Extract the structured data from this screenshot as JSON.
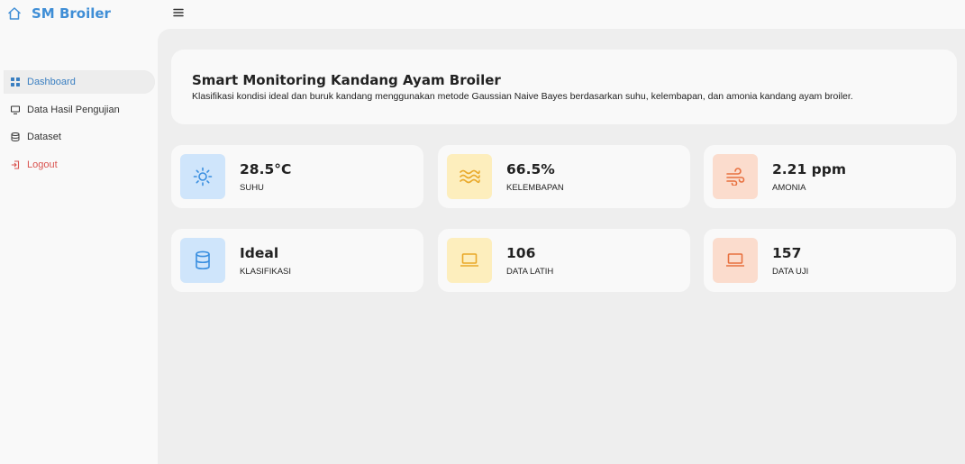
{
  "brand": {
    "name": "SM Broiler",
    "icon": "home-icon"
  },
  "topbar": {
    "menu_icon": "hamburger-icon"
  },
  "sidebar": {
    "items": [
      {
        "label": "Dashboard",
        "icon": "grid-icon",
        "active": true
      },
      {
        "label": "Data Hasil Pengujian",
        "icon": "monitor-icon",
        "active": false
      },
      {
        "label": "Dataset",
        "icon": "database-icon",
        "active": false
      },
      {
        "label": "Logout",
        "icon": "logout-icon",
        "active": false
      }
    ]
  },
  "hero": {
    "title": "Smart Monitoring Kandang Ayam Broiler",
    "subtitle": "Klasifikasi kondisi ideal dan buruk kandang menggunakan metode Gaussian Naive Bayes berdasarkan suhu, kelembapan, dan amonia kandang ayam broiler."
  },
  "cards": [
    {
      "value": "28.5°C",
      "label": "SUHU",
      "icon": "sun-icon",
      "color": "#3a8fe0"
    },
    {
      "value": "66.5%",
      "label": "KELEMBAPAN",
      "icon": "water-icon",
      "color": "#e9a92a"
    },
    {
      "value": "2.21 ppm",
      "label": "AMONIA",
      "icon": "wind-icon",
      "color": "#e8703f"
    },
    {
      "value": "Ideal",
      "label": "KLASIFIKASI",
      "icon": "database-icon",
      "color": "#3a8fe0"
    },
    {
      "value": "106",
      "label": "DATA LATIH",
      "icon": "laptop-icon",
      "color": "#e9a92a"
    },
    {
      "value": "157",
      "label": "DATA UJI",
      "icon": "laptop-icon",
      "color": "#e8703f"
    }
  ],
  "colors": {
    "brand": "#3f8ed6",
    "logout": "#d9534f",
    "blue_bg": "#cfe5fb",
    "yellow_bg": "#fdeebd",
    "orange_bg": "#fbdccd"
  }
}
